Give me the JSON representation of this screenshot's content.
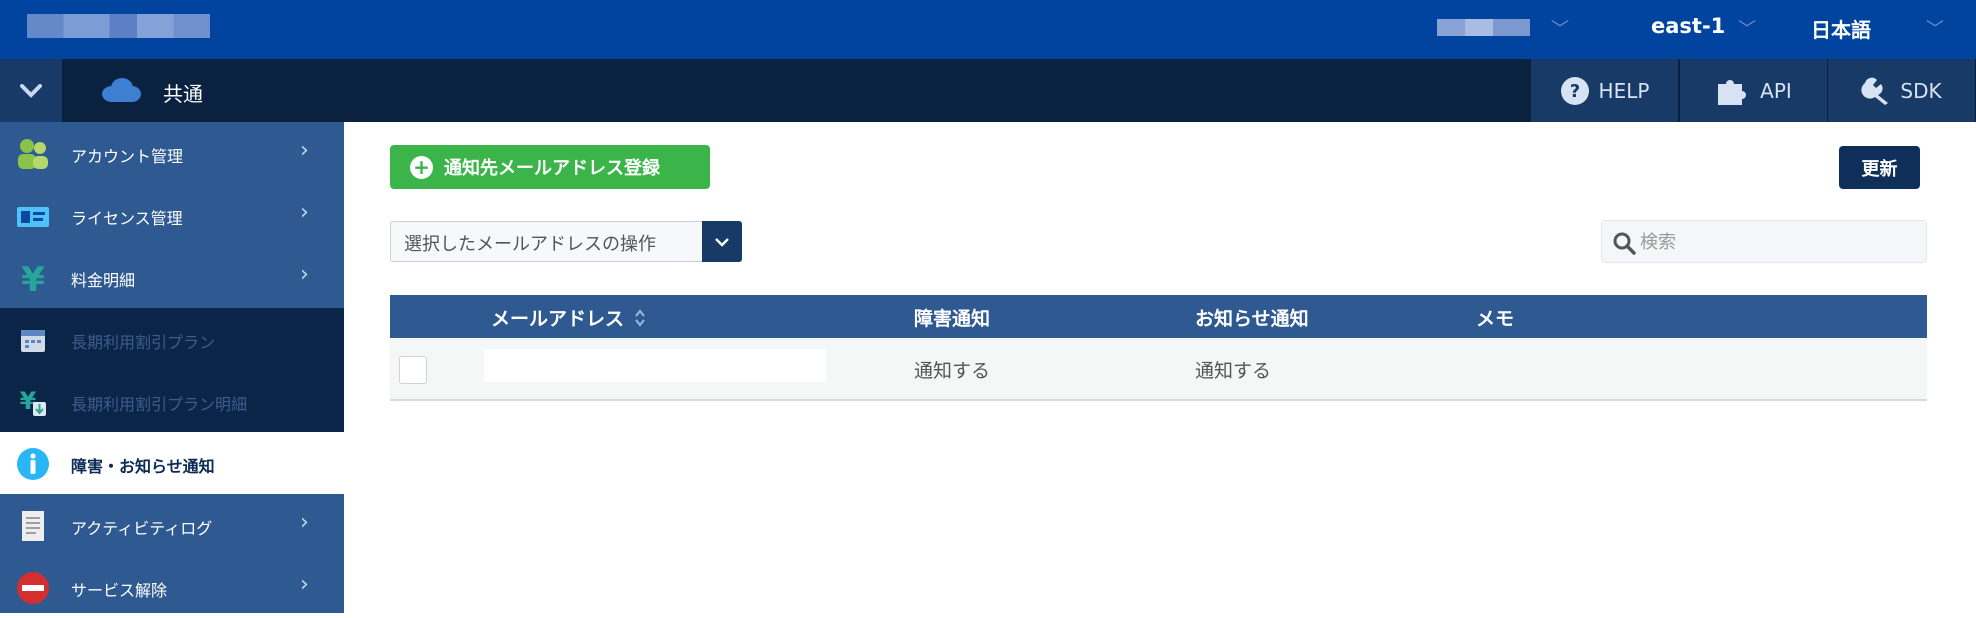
{
  "header": {
    "region": "east-1",
    "language": "日本語"
  },
  "toolbar": {
    "section_title": "共通",
    "help_label": "HELP",
    "api_label": "API",
    "sdk_label": "SDK"
  },
  "sidebar": {
    "items": [
      {
        "label": "アカウント管理",
        "icon": "people-icon",
        "chevron": true,
        "style": "normal"
      },
      {
        "label": "ライセンス管理",
        "icon": "id-card-icon",
        "chevron": true,
        "style": "normal"
      },
      {
        "label": "料金明細",
        "icon": "yen-icon",
        "chevron": true,
        "style": "normal"
      },
      {
        "label": "長期利用割引プラン",
        "icon": "calendar-icon",
        "chevron": false,
        "style": "disabled"
      },
      {
        "label": "長期利用割引プラン明細",
        "icon": "yen-download-icon",
        "chevron": false,
        "style": "disabled"
      },
      {
        "label": "障害・お知らせ通知",
        "icon": "info-icon",
        "chevron": false,
        "style": "active"
      },
      {
        "label": "アクティビティログ",
        "icon": "document-icon",
        "chevron": true,
        "style": "normal"
      },
      {
        "label": "サービス解除",
        "icon": "no-entry-icon",
        "chevron": true,
        "style": "normal"
      }
    ]
  },
  "main": {
    "add_button_label": "通知先メールアドレス登録",
    "refresh_button_label": "更新",
    "bulk_action_placeholder": "選択したメールアドレスの操作",
    "search_placeholder": "検索",
    "table": {
      "columns": [
        "メールアドレス",
        "障害通知",
        "お知らせ通知",
        "メモ"
      ],
      "rows": [
        {
          "email": "",
          "fault_notice": "通知する",
          "news_notice": "通知する",
          "memo": ""
        }
      ]
    }
  },
  "colors": {
    "topbar": "#0044a0",
    "subbar": "#0a2140",
    "sidebar": "#2f5a91",
    "accent_green": "#3bb54a",
    "dark_button": "#0f2f5a"
  }
}
